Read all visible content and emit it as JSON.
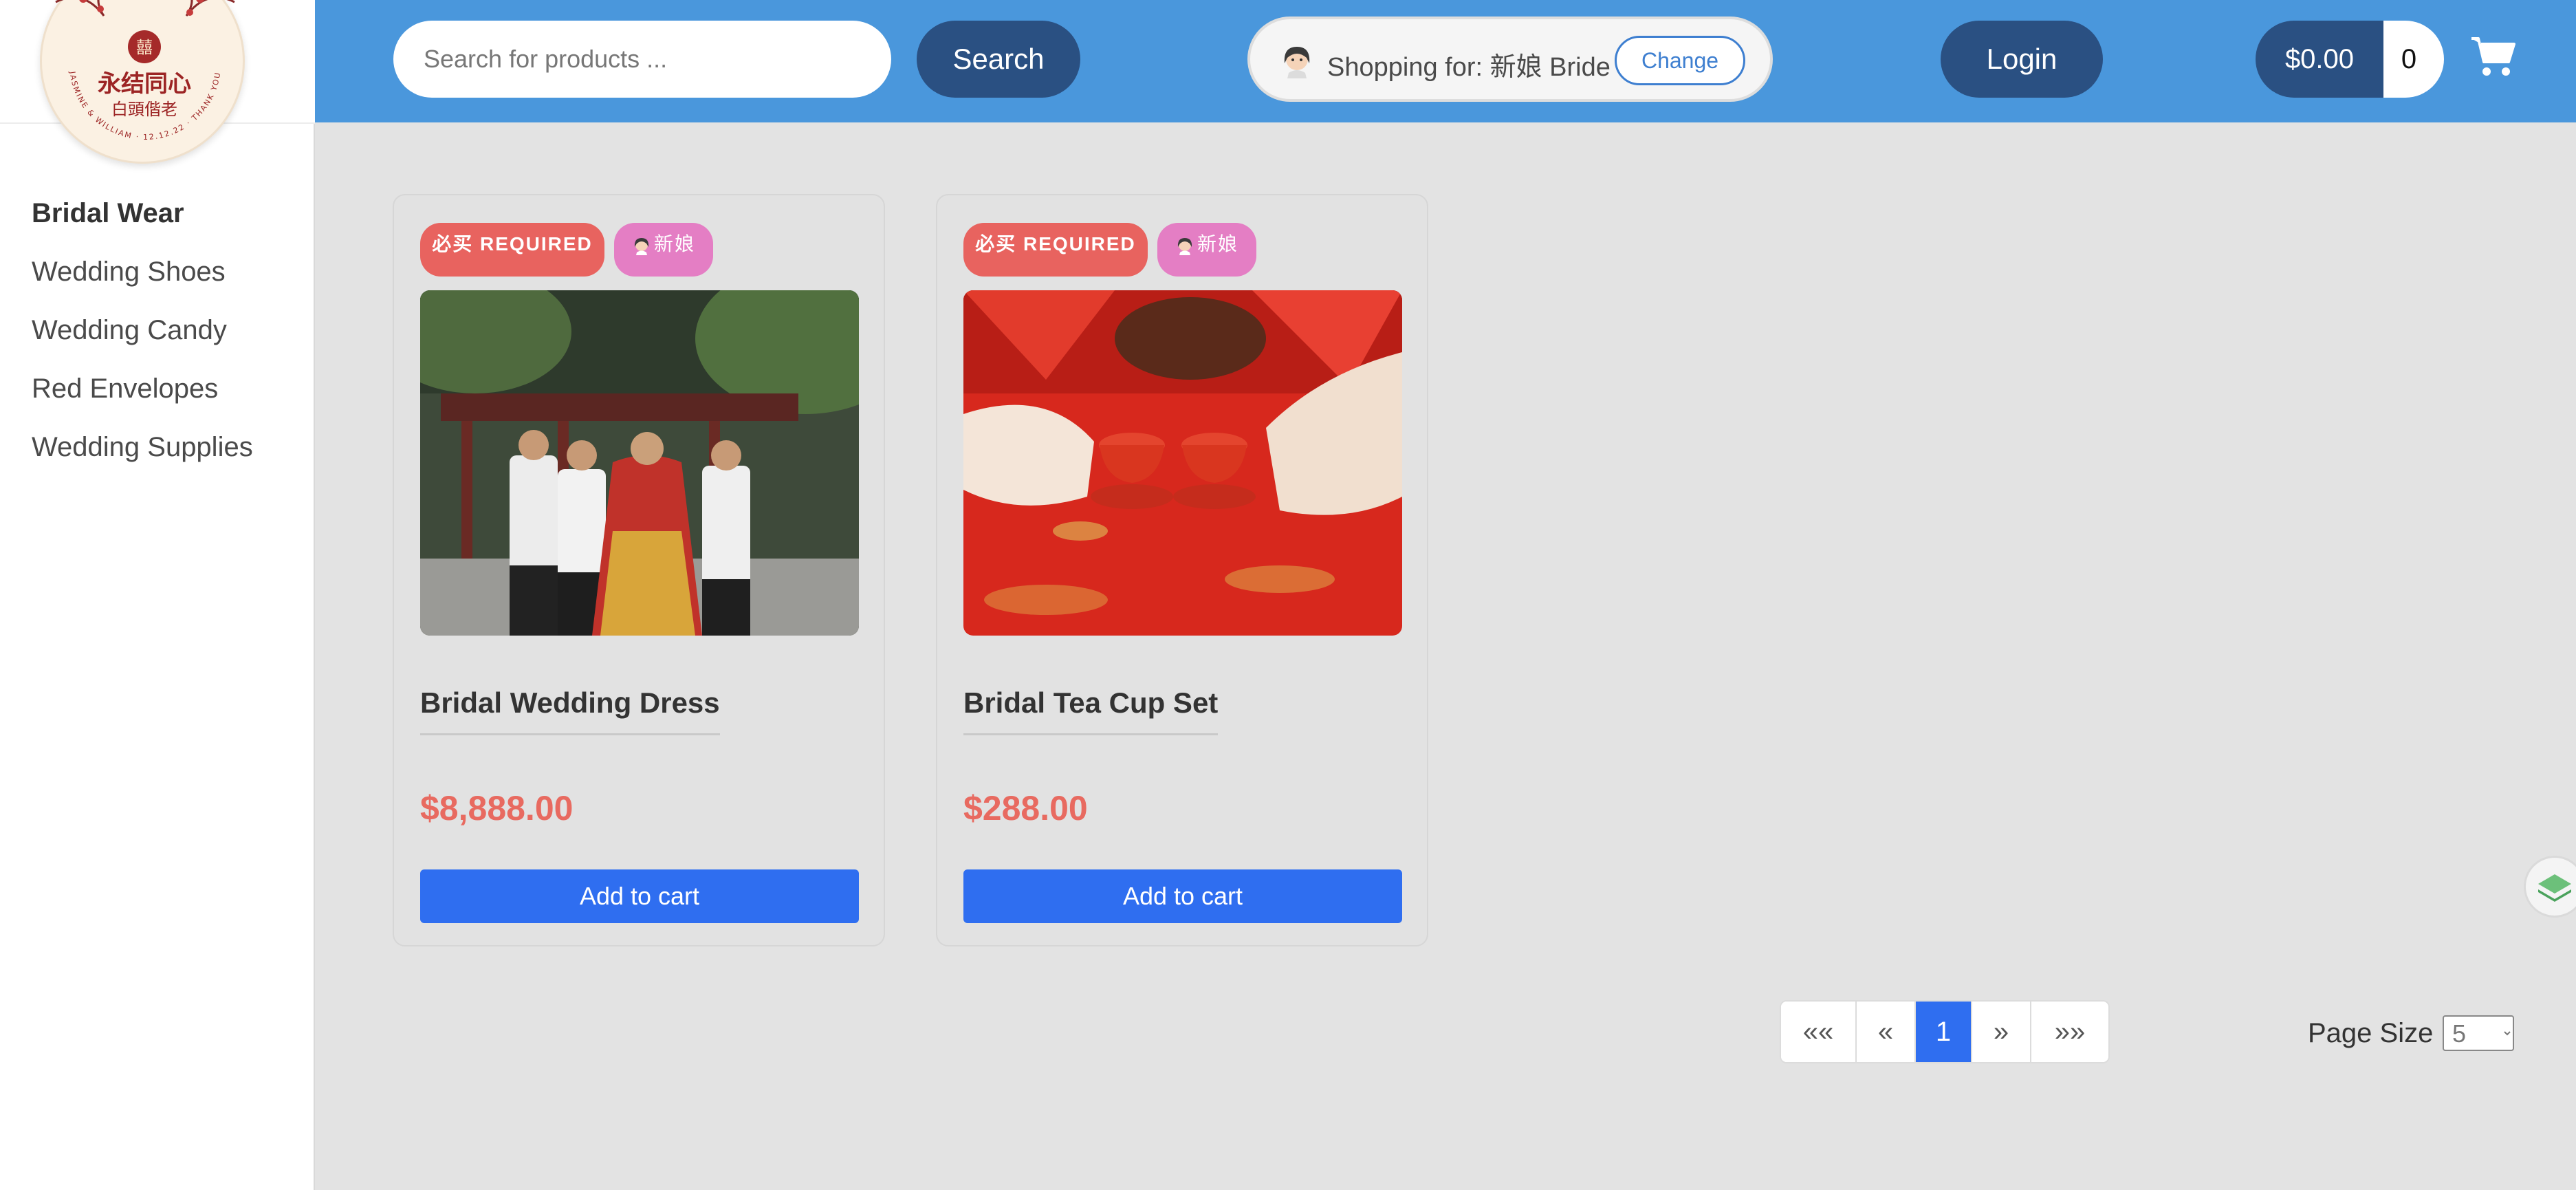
{
  "sidebar": {
    "categories": [
      {
        "label": "Bridal Wear"
      },
      {
        "label": "Wedding Shoes"
      },
      {
        "label": "Wedding Candy"
      },
      {
        "label": "Red Envelopes"
      },
      {
        "label": "Wedding Supplies"
      }
    ],
    "active_category": "Bridal Wear",
    "logo": {
      "text_main": "永结同心",
      "text_sub": "白頭偕老",
      "ring_text": "JASMINE & WILLIAM · 12.12.22 · THANK YOU",
      "symbol": "囍"
    }
  },
  "header": {
    "search_placeholder": "Search for products ...",
    "search_button": "Search",
    "shopping_for_label": "Shopping for: 新娘 Bride",
    "change_button": "Change",
    "login_button": "Login",
    "cart_total": "$0.00",
    "cart_count": "0"
  },
  "products": [
    {
      "badge_required": "必买 REQUIRED",
      "badge_role": "新娘",
      "name": "Bridal Wedding Dress",
      "price": "$8,888.00",
      "add_to_cart": "Add to cart"
    },
    {
      "badge_required": "必买 REQUIRED",
      "badge_role": "新娘",
      "name": "Bridal Tea Cup Set",
      "price": "$288.00",
      "add_to_cart": "Add to cart"
    }
  ],
  "pagination": {
    "first": "«« ",
    "prev": "«",
    "current": "1",
    "next": "»",
    "last": "»»",
    "page_size_label": "Page Size",
    "page_size_value": "5"
  },
  "colors": {
    "header_bg": "#4a97dc",
    "pill_button": "#2a5082",
    "accent_blue": "#2f6ef0",
    "price_red": "#e86a60",
    "badge_red": "#e8635f",
    "badge_pink": "#e47ec4"
  }
}
